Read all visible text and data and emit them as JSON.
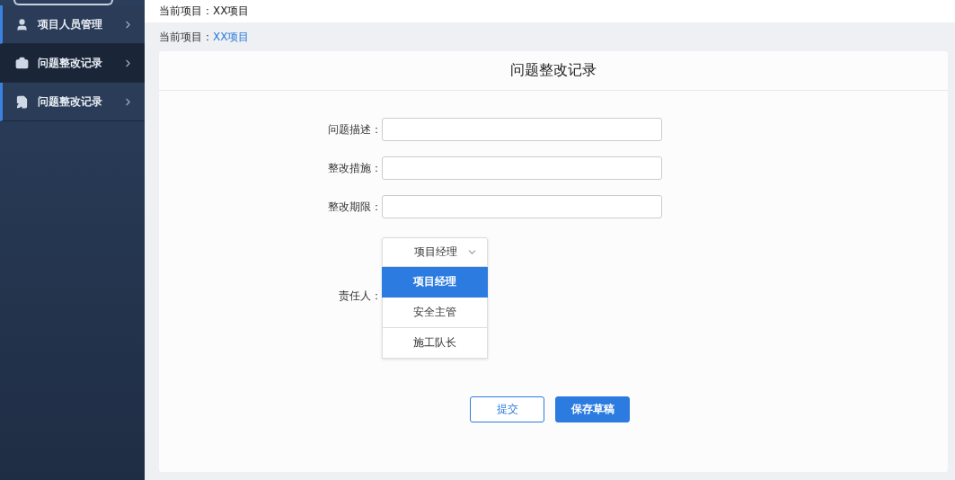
{
  "sidebar": {
    "items": [
      {
        "label": "项目人员管理",
        "selected": false
      },
      {
        "label": "问题整改记录",
        "selected": true
      },
      {
        "label": "问题整改记录",
        "selected": false
      }
    ]
  },
  "top_bar": {
    "text": "当前项目：XX项目"
  },
  "breadcrumb": {
    "label": "当前项目：",
    "link": "XX项目"
  },
  "form": {
    "title": "问题整改记录",
    "fields": [
      {
        "label": "问题描述："
      },
      {
        "label": "整改措施："
      },
      {
        "label": "整改期限："
      }
    ],
    "select": {
      "label": "责任人：",
      "value": "项目经理",
      "expanded": true,
      "options": [
        {
          "label": "项目经理",
          "selected": true
        },
        {
          "label": "安全主管",
          "selected": false
        },
        {
          "label": "施工队长",
          "selected": false
        }
      ]
    },
    "buttons": [
      {
        "label": "提交",
        "kind": "outline"
      },
      {
        "label": "保存草稿",
        "kind": "primary"
      }
    ]
  }
}
